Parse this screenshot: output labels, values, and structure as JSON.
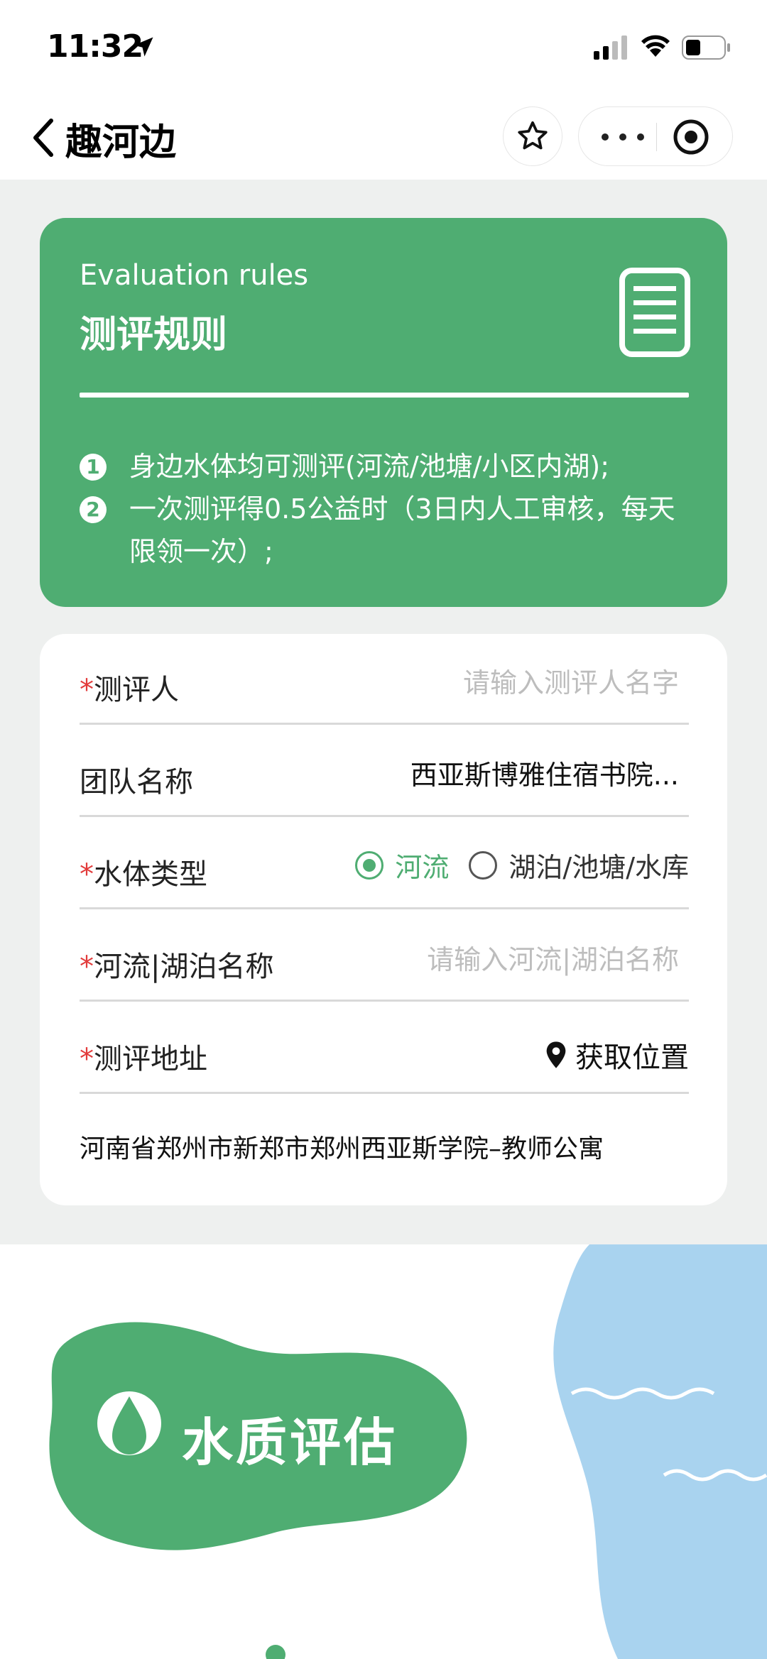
{
  "status_bar": {
    "time": "11:32"
  },
  "nav": {
    "title": "趣河边"
  },
  "rules": {
    "title_en": "Evaluation rules",
    "title_zh": "测评规则",
    "items": [
      {
        "num": "1",
        "text": "身边水体均可测评(河流/池塘/小区内湖);"
      },
      {
        "num": "2",
        "text": "一次测评得0.5公益时（3日内人工审核，每天限领一次）;"
      }
    ]
  },
  "form": {
    "required_mark": "*",
    "evaluator": {
      "label": "测评人",
      "placeholder": "请输入测评人名字"
    },
    "team": {
      "label": "团队名称",
      "value": "西亚斯博雅住宿书院..."
    },
    "water_type": {
      "label": "水体类型",
      "options": [
        "河流",
        "湖泊/池塘/水库"
      ],
      "selected": "河流"
    },
    "water_name": {
      "label": "河流|湖泊名称",
      "placeholder": "请输入河流|湖泊名称"
    },
    "address": {
      "label": "测评地址",
      "get_location": "获取位置",
      "value": "河南省郑州市新郑市郑州西亚斯学院–教师公寓"
    }
  },
  "banner": {
    "title": "水质评估"
  },
  "colors": {
    "brand_green": "#4fad72",
    "water_blue": "#a9d3ef",
    "required_red": "#e23b3b"
  }
}
